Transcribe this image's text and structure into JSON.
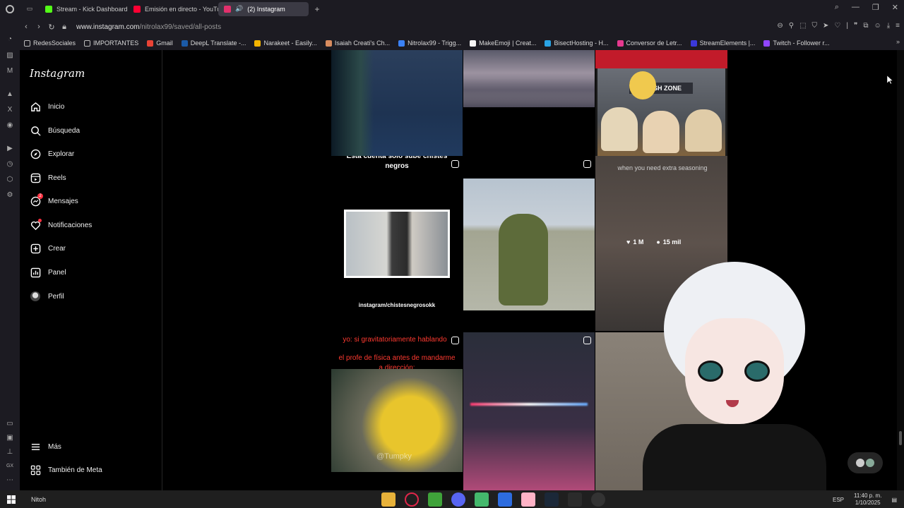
{
  "browser": {
    "tabs": [
      {
        "title": "Stream - Kick Dashboard",
        "color": "#53fc18"
      },
      {
        "title": "Emisión en directo - YouTube",
        "color": "#ff0033"
      },
      {
        "title": "(2) Instagram",
        "color": "#e1306c"
      }
    ],
    "url_domain": "www.instagram.com",
    "url_path": "/nitrolax99/saved/all-posts",
    "bookmarks": [
      {
        "label": "RedesSociales",
        "color": "#888"
      },
      {
        "label": "IMPORTANTES",
        "color": "#888"
      },
      {
        "label": "Gmail",
        "color": "#ea4335"
      },
      {
        "label": "DeepL Translate -...",
        "color": "#0f2b46"
      },
      {
        "label": "Narakeet - Easily...",
        "color": "#f4b400"
      },
      {
        "label": "Isaiah Creati's Ch...",
        "color": "#d98c5f"
      },
      {
        "label": "Nitrolax99 - Trigg...",
        "color": "#3b82f6"
      },
      {
        "label": "MakeEmoji | Creat...",
        "color": "#f5f5f5"
      },
      {
        "label": "BisectHosting - H...",
        "color": "#2aa4e6"
      },
      {
        "label": "Conversor de Letr...",
        "color": "#e6398f"
      },
      {
        "label": "StreamElements |...",
        "color": "#3b38d9"
      },
      {
        "label": "Twitch - Follower r...",
        "color": "#9146ff"
      }
    ]
  },
  "instagram": {
    "logo": "Instagram",
    "nav": [
      {
        "label": "Inicio",
        "icon": "home-icon"
      },
      {
        "label": "Búsqueda",
        "icon": "search-icon"
      },
      {
        "label": "Explorar",
        "icon": "compass-icon"
      },
      {
        "label": "Reels",
        "icon": "reels-icon"
      },
      {
        "label": "Mensajes",
        "icon": "messenger-icon",
        "badge": "2"
      },
      {
        "label": "Notificaciones",
        "icon": "heart-icon"
      },
      {
        "label": "Crear",
        "icon": "plus-square-icon"
      },
      {
        "label": "Panel",
        "icon": "chart-icon"
      },
      {
        "label": "Perfil",
        "icon": "profile-avatar"
      }
    ],
    "more": "Más",
    "meta": "También de Meta"
  },
  "posts": {
    "p4_caption": "Esta cuenta solo sube chistes negros",
    "p4_watermark": "instagram/chistesnegrosokk",
    "p6_caption": "when you need extra seasoning",
    "p6_likes": "1 M",
    "p6_comments": "15 mil",
    "p7_line1": "yo: si gravitatoriamente hablando",
    "p7_line2": "el profe de física antes de mandarme a dirección:",
    "p7_watermark": "@Tumpky",
    "p3_sign": "FRESH ZONE"
  },
  "taskbar": {
    "user": "Nitoh",
    "lang": "ESP",
    "time": "11:40 p. m.",
    "date": "1/10/2025"
  }
}
